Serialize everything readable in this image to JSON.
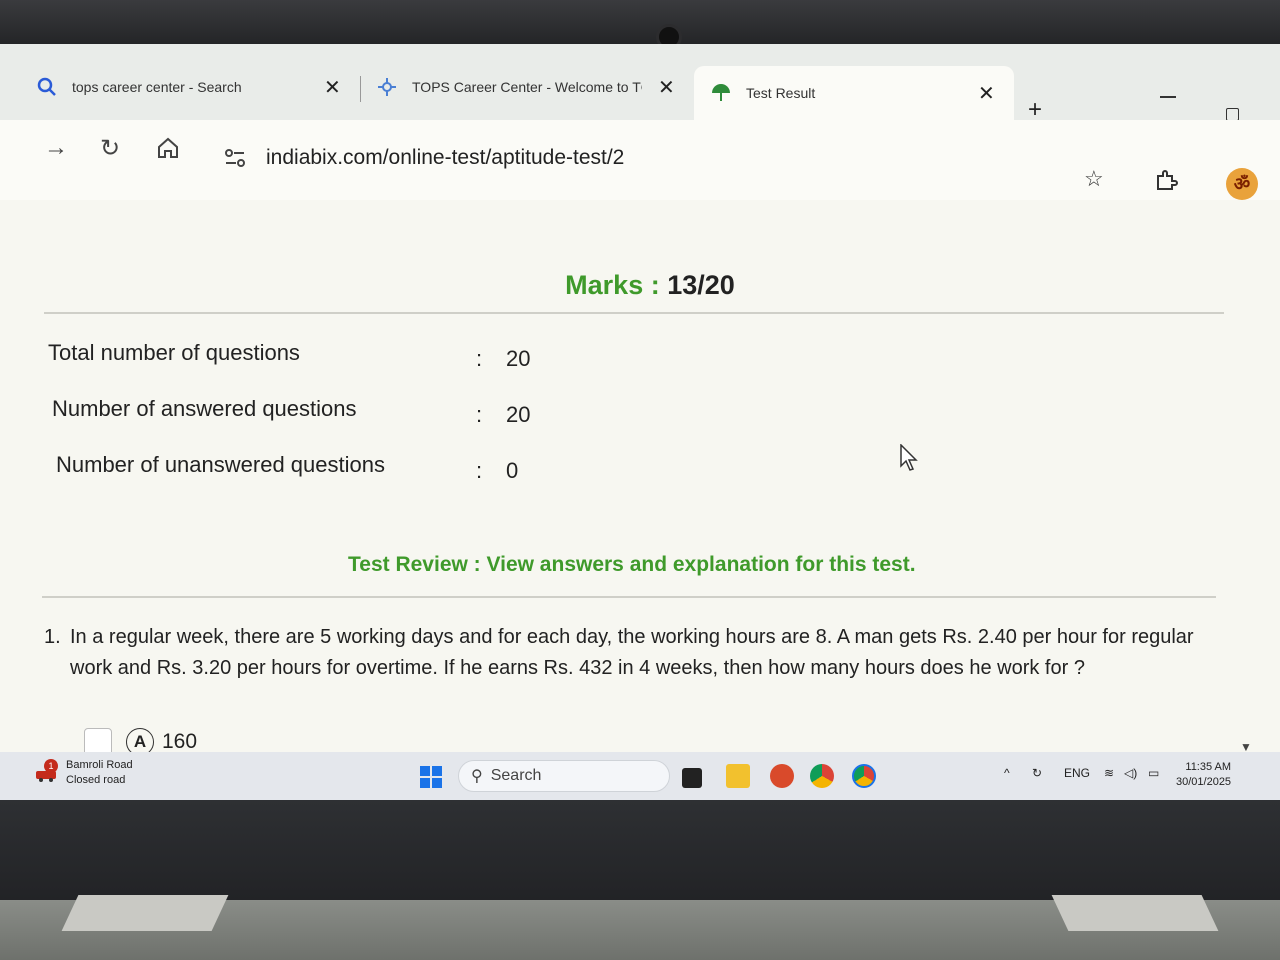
{
  "browser": {
    "tabs": [
      {
        "title": "tops career center - Search",
        "icon": "search-icon"
      },
      {
        "title": "TOPS Career Center - Welcome to TC",
        "icon": "site-logo-icon"
      },
      {
        "title": "Test Result",
        "icon": "umbrella-icon",
        "active": true
      }
    ],
    "new_tab_label": "+",
    "url": "indiabix.com/online-test/aptitude-test/2",
    "profile_initial": "ॐ"
  },
  "result": {
    "marks_label": "Marks :",
    "marks_value": "13/20",
    "stats": [
      {
        "label": "Total number of questions",
        "value": "20"
      },
      {
        "label": "Number of answered questions",
        "value": "20"
      },
      {
        "label": "Number of unanswered questions",
        "value": "0"
      }
    ],
    "colon": ":"
  },
  "review": {
    "prefix": "Test Review :",
    "link": "View answers and explanation for this test."
  },
  "question": {
    "number": "1.",
    "text": "In a regular week, there are 5 working days and for each day, the working hours are 8. A man gets Rs. 2.40 per hour for regular work and Rs. 3.20 per hours for overtime. If he earns Rs. 432 in 4 weeks, then how many hours does he work for ?",
    "options": [
      {
        "letter": "A",
        "value": "160"
      }
    ]
  },
  "taskbar": {
    "weather_title": "Bamroli Road",
    "weather_sub": "Closed road",
    "weather_badge": "1",
    "search_placeholder": "Search",
    "language": "ENG",
    "time": "11:35 AM",
    "date": "30/01/2025"
  },
  "colors": {
    "accent_green": "#3f9a2b",
    "text_dark": "#222222"
  }
}
